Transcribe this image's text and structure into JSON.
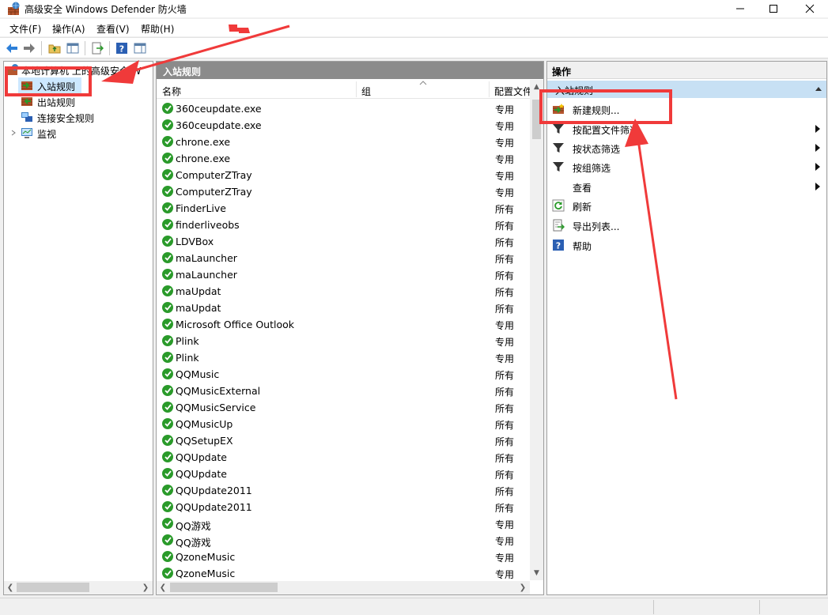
{
  "window": {
    "title": "高级安全 Windows Defender 防火墙"
  },
  "menu": {
    "items": [
      "文件(F)",
      "操作(A)",
      "查看(V)",
      "帮助(H)"
    ]
  },
  "tree": {
    "root_label": "本地计算机 上的高级安全 W",
    "items": [
      {
        "label": "入站规则",
        "selected": true
      },
      {
        "label": "出站规则",
        "selected": false
      },
      {
        "label": "连接安全规则",
        "selected": false
      },
      {
        "label": "监视",
        "selected": false
      }
    ]
  },
  "center": {
    "header": "入站规则",
    "columns": {
      "name": "名称",
      "group": "组",
      "profile": "配置文件"
    },
    "rows": [
      {
        "name": "360ceupdate.exe",
        "profile": "专用"
      },
      {
        "name": "360ceupdate.exe",
        "profile": "专用"
      },
      {
        "name": "chrone.exe",
        "profile": "专用"
      },
      {
        "name": "chrone.exe",
        "profile": "专用"
      },
      {
        "name": "ComputerZTray",
        "profile": "专用"
      },
      {
        "name": "ComputerZTray",
        "profile": "专用"
      },
      {
        "name": "FinderLive",
        "profile": "所有"
      },
      {
        "name": "finderliveobs",
        "profile": "所有"
      },
      {
        "name": "LDVBox",
        "profile": "所有"
      },
      {
        "name": "maLauncher",
        "profile": "所有"
      },
      {
        "name": "maLauncher",
        "profile": "所有"
      },
      {
        "name": "maUpdat",
        "profile": "所有"
      },
      {
        "name": "maUpdat",
        "profile": "所有"
      },
      {
        "name": "Microsoft Office Outlook",
        "profile": "专用"
      },
      {
        "name": "Plink",
        "profile": "专用"
      },
      {
        "name": "Plink",
        "profile": "专用"
      },
      {
        "name": "QQMusic",
        "profile": "所有"
      },
      {
        "name": "QQMusicExternal",
        "profile": "所有"
      },
      {
        "name": "QQMusicService",
        "profile": "所有"
      },
      {
        "name": "QQMusicUp",
        "profile": "所有"
      },
      {
        "name": "QQSetupEX",
        "profile": "所有"
      },
      {
        "name": "QQUpdate",
        "profile": "所有"
      },
      {
        "name": "QQUpdate",
        "profile": "所有"
      },
      {
        "name": "QQUpdate2011",
        "profile": "所有"
      },
      {
        "name": "QQUpdate2011",
        "profile": "所有"
      },
      {
        "name": "QQ游戏",
        "profile": "专用"
      },
      {
        "name": "QQ游戏",
        "profile": "专用"
      },
      {
        "name": "QzoneMusic",
        "profile": "专用"
      },
      {
        "name": "QzoneMusic",
        "profile": "专用"
      }
    ]
  },
  "actions": {
    "header": "操作",
    "section": "入站规则",
    "items": [
      {
        "label": "新建规则...",
        "icon": "new-rule-icon",
        "submenu": false
      },
      {
        "label": "按配置文件筛选",
        "icon": "filter-icon",
        "submenu": true
      },
      {
        "label": "按状态筛选",
        "icon": "filter-icon",
        "submenu": true
      },
      {
        "label": "按组筛选",
        "icon": "filter-icon",
        "submenu": true
      },
      {
        "label": "查看",
        "icon": "",
        "submenu": true
      },
      {
        "label": "刷新",
        "icon": "refresh-icon",
        "submenu": false
      },
      {
        "label": "导出列表...",
        "icon": "export-icon",
        "submenu": false
      },
      {
        "label": "帮助",
        "icon": "help-icon",
        "submenu": false
      }
    ]
  },
  "colors": {
    "annotation": "#f03a3a",
    "selection": "#cce8ff",
    "center_header": "#8b8b8b",
    "actions_section": "#c7e0f4",
    "enabled_check": "#2a9a2a"
  }
}
